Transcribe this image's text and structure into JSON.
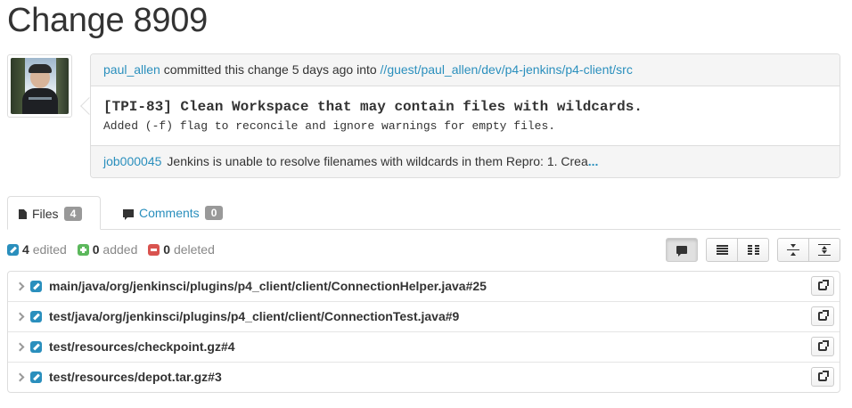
{
  "page": {
    "title": "Change 8909"
  },
  "commit": {
    "author": "paul_allen",
    "committed_text": "committed this change 5 days ago into",
    "path": "//guest/paul_allen/dev/p4-jenkins/p4-client/src",
    "subject": "[TPI-83] Clean Workspace that may contain files with wildcards.",
    "description": "Added (-f) flag to reconcile and ignore warnings for empty files.",
    "job": {
      "id": "job000045",
      "text": "Jenkins is unable to resolve filenames with wildcards in them Repro: 1. Crea",
      "more": "..."
    }
  },
  "tabs": [
    {
      "label": "Files",
      "count": "4",
      "icon": "file-icon"
    },
    {
      "label": "Comments",
      "count": "0",
      "icon": "comment-icon"
    }
  ],
  "stats": {
    "edited": {
      "count": "4",
      "label": "edited"
    },
    "added": {
      "count": "0",
      "label": "added"
    },
    "deleted": {
      "count": "0",
      "label": "deleted"
    }
  },
  "files": [
    {
      "path": "main/java/org/jenkinsci/plugins/p4_client/client/ConnectionHelper.java#25"
    },
    {
      "path": "test/java/org/jenkinsci/plugins/p4_client/client/ConnectionTest.java#9"
    },
    {
      "path": "test/resources/checkpoint.gz#4"
    },
    {
      "path": "test/resources/depot.tar.gz#3"
    }
  ],
  "colors": {
    "link": "#2a8fbd",
    "edited": "#2a8fbd",
    "added": "#5cb85c",
    "deleted": "#d9534f"
  }
}
